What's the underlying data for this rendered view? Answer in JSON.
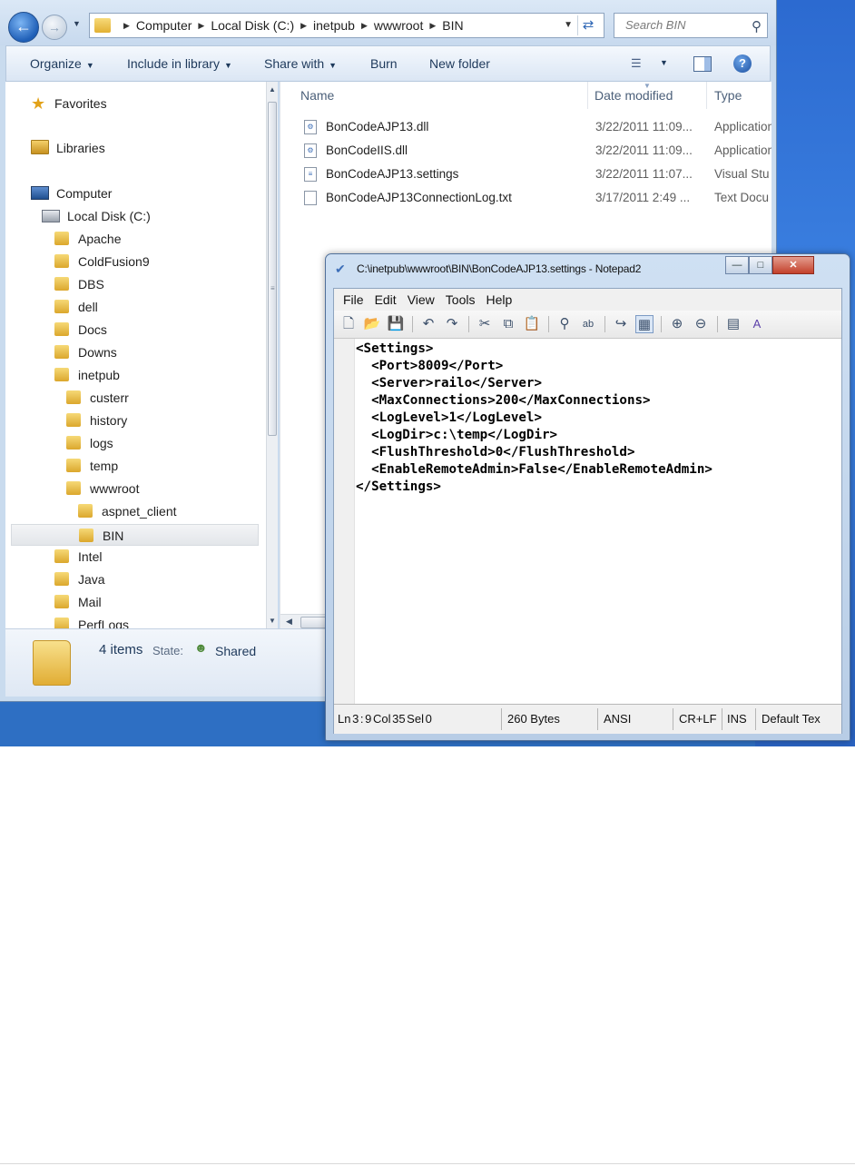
{
  "explorer": {
    "breadcrumb": [
      "Computer",
      "Local Disk (C:)",
      "inetpub",
      "wwwroot",
      "BIN"
    ],
    "search_placeholder": "Search BIN",
    "toolbar": {
      "organize": "Organize",
      "include_in_library": "Include in library",
      "share_with": "Share with",
      "burn": "Burn",
      "new_folder": "New folder"
    },
    "nav": {
      "favorites": "Favorites",
      "libraries": "Libraries",
      "computer": "Computer",
      "local_disk": "Local Disk (C:)",
      "level1": [
        "Apache",
        "ColdFusion9",
        "DBS",
        "dell",
        "Docs",
        "Downs",
        "inetpub"
      ],
      "inetpub_children": [
        "custerr",
        "history",
        "logs",
        "temp",
        "wwwroot"
      ],
      "wwwroot_children": [
        "aspnet_client",
        "BIN"
      ],
      "level1_after": [
        "Intel",
        "Java",
        "Mail",
        "PerfLogs"
      ],
      "selected": "BIN"
    },
    "columns": {
      "name": "Name",
      "date": "Date modified",
      "type": "Type"
    },
    "files": [
      {
        "name": "BonCodeAJP13.dll",
        "date": "3/22/2011 11:09...",
        "type": "Application",
        "icon": "dll-file-icon"
      },
      {
        "name": "BonCodeIIS.dll",
        "date": "3/22/2011 11:09...",
        "type": "Application",
        "icon": "dll-file-icon"
      },
      {
        "name": "BonCodeAJP13.settings",
        "date": "3/22/2011 11:07...",
        "type": "Visual Stu",
        "icon": "settings-file-icon"
      },
      {
        "name": "BonCodeAJP13ConnectionLog.txt",
        "date": "3/17/2011 2:49 ...",
        "type": "Text Docu",
        "icon": "text-file-icon"
      }
    ],
    "details": {
      "count": "4 items",
      "state_label": "State:",
      "state_value": "Shared"
    }
  },
  "notepad": {
    "title": "C:\\inetpub\\wwwroot\\BIN\\BonCodeAJP13.settings - Notepad2",
    "menu": [
      "File",
      "Edit",
      "View",
      "Tools",
      "Help"
    ],
    "content_lines": [
      "<Settings>",
      "  <Port>8009</Port>",
      "  <Server>railo</Server>",
      "  <MaxConnections>200</MaxConnections>",
      "  <LogLevel>1</LogLevel>",
      "  <LogDir>c:\\temp</LogDir>",
      "  <FlushThreshold>0</FlushThreshold>",
      "  <EnableRemoteAdmin>False</EnableRemoteAdmin>",
      "</Settings>"
    ],
    "status": {
      "position": "Ln 3 : 9   Col 35   Sel 0",
      "size": "260 Bytes",
      "encoding": "ANSI",
      "line_endings": "CR+LF",
      "insert_mode": "INS",
      "scheme": "Default Tex"
    }
  }
}
